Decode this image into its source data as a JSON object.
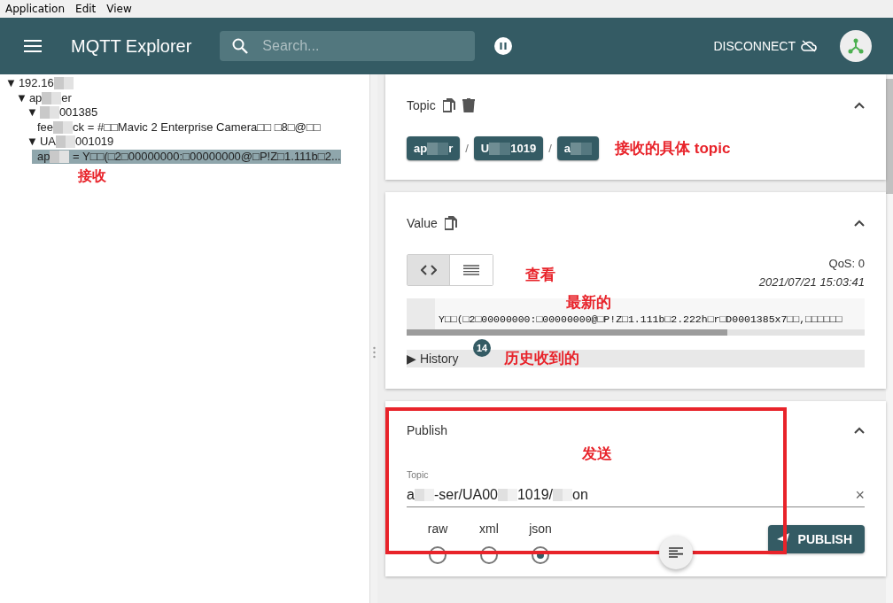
{
  "menu": [
    "Application",
    "Edit",
    "View"
  ],
  "header": {
    "title": "MQTT Explorer",
    "search": {
      "placeholder": "Search..."
    },
    "paused": true,
    "disconnect": "DISCONNECT"
  },
  "tree": [
    {
      "icon": "▼",
      "segments": [
        {
          "kind": "text",
          "text": "192.16"
        },
        {
          "kind": "blur"
        }
      ],
      "expanded": true,
      "children": [
        {
          "icon": "▼",
          "segments": [
            {
              "kind": "text",
              "text": "ap"
            },
            {
              "kind": "blur"
            },
            {
              "kind": "text",
              "text": "er"
            }
          ],
          "expanded": true,
          "children": [
            {
              "icon": "▼",
              "segments": [
                {
                  "kind": "blur"
                },
                {
                  "kind": "text",
                  "text": "001385"
                }
              ],
              "expanded": true,
              "children": [
                {
                  "segments": [
                    {
                      "kind": "text",
                      "text": "fee"
                    },
                    {
                      "kind": "blur"
                    },
                    {
                      "kind": "text",
                      "text": "ck"
                    }
                  ],
                  "value": "= #□□Mavic 2 Enterprise Camera□□ □8□@□□",
                  "selected": false
                }
              ]
            },
            {
              "icon": "▼",
              "segments": [
                {
                  "kind": "text",
                  "text": "UA"
                },
                {
                  "kind": "blur"
                },
                {
                  "kind": "text",
                  "text": "001019"
                }
              ],
              "expanded": true,
              "children": [
                {
                  "segments": [
                    {
                      "kind": "text",
                      "text": "ap"
                    },
                    {
                      "kind": "blur"
                    }
                  ],
                  "value": "= Y□□(□2□00000000:□00000000@□P!Z□1.111b□2...",
                  "selected": true
                }
              ]
            }
          ]
        }
      ]
    }
  ],
  "tree_note": "接收",
  "topic": {
    "title": "Topic",
    "separators": [
      "/",
      "/"
    ],
    "chips": [
      {
        "segments": [
          {
            "kind": "text",
            "text": "ap"
          },
          {
            "kind": "blur"
          },
          {
            "kind": "text",
            "text": "r"
          }
        ]
      },
      {
        "segments": [
          {
            "kind": "text",
            "text": "U"
          },
          {
            "kind": "blur"
          },
          {
            "kind": "text",
            "text": "1019"
          }
        ]
      },
      {
        "segments": [
          {
            "kind": "text",
            "text": "a"
          },
          {
            "kind": "blur"
          }
        ]
      }
    ],
    "note": "接收的具体 topic"
  },
  "value": {
    "title": "Value",
    "views": [
      {
        "kind": "code",
        "selected": true
      },
      {
        "kind": "lines",
        "selected": false
      }
    ],
    "note": "查看",
    "qos": "QoS: 0",
    "timestamp": "2021/07/21 15:03:41",
    "payload": "Y□□(□2□00000000:□00000000@□P!Z□1.111b□2.222h□r□D0001385x7□□,□□□□□□",
    "scroll_note": "最新的",
    "history_icon": "▶",
    "history": "History",
    "history_count": "14",
    "history_note": "历史收到的"
  },
  "publish": {
    "title": "Publish",
    "note": "发送",
    "highlight": true,
    "topic_label": "Topic",
    "topic_segments": [
      {
        "kind": "text",
        "text": "a"
      },
      {
        "kind": "blur"
      },
      {
        "kind": "text",
        "text": "-ser/UA00"
      },
      {
        "kind": "blur"
      },
      {
        "kind": "text",
        "text": "1019/"
      },
      {
        "kind": "blur"
      },
      {
        "kind": "text",
        "text": "on"
      }
    ],
    "clear_icon": "×",
    "formats": [
      {
        "label": "raw",
        "selected": false
      },
      {
        "label": "xml",
        "selected": false
      },
      {
        "label": "json",
        "selected": true
      }
    ],
    "button": "PUBLISH"
  }
}
